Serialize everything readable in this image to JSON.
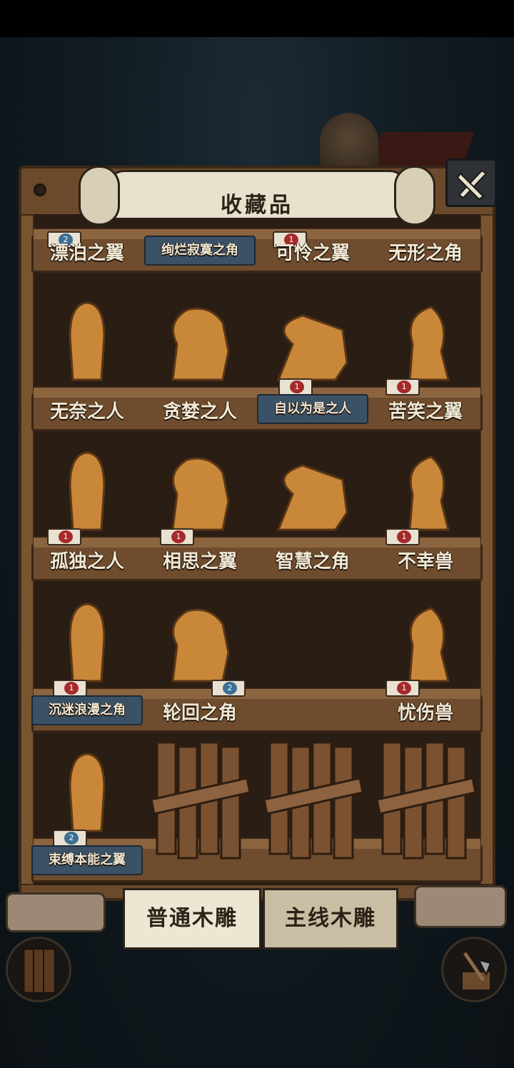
{
  "header": {
    "title": "收藏品"
  },
  "shelves": [
    {
      "items": [
        {
          "label": "漂泊之翼",
          "badge": "2",
          "badge_color": "blue",
          "style": "plain"
        },
        {
          "label": "绚烂寂寞之角",
          "badge": "",
          "style": "blue"
        },
        {
          "label": "可怜之翼",
          "badge": "1",
          "badge_color": "red",
          "style": "plain"
        },
        {
          "label": "无形之角",
          "badge": "",
          "style": "plain"
        }
      ]
    },
    {
      "items": [
        {
          "label": "无奈之人",
          "badge": "",
          "style": "plain"
        },
        {
          "label": "贪婪之人",
          "badge": "",
          "style": "plain"
        },
        {
          "label": "自以为是之人",
          "badge": "1",
          "badge_color": "red",
          "style": "blue"
        },
        {
          "label": "苦笑之翼",
          "badge": "1",
          "badge_color": "red",
          "style": "plain"
        }
      ]
    },
    {
      "items": [
        {
          "label": "孤独之人",
          "badge": "1",
          "badge_color": "red",
          "style": "plain"
        },
        {
          "label": "相思之翼",
          "badge": "1",
          "badge_color": "red",
          "style": "plain"
        },
        {
          "label": "智慧之角",
          "badge": "",
          "style": "plain"
        },
        {
          "label": "不幸兽",
          "badge": "1",
          "badge_color": "red",
          "style": "plain"
        }
      ]
    },
    {
      "items": [
        {
          "label": "沉迷浪漫之角",
          "badge": "1",
          "badge_color": "red",
          "style": "blue"
        },
        {
          "label": "轮回之角",
          "badge": "2",
          "badge_color": "blue",
          "style": "plain"
        },
        {
          "label": "",
          "badge": "",
          "style": "empty"
        },
        {
          "label": "忧伤兽",
          "badge": "1",
          "badge_color": "red",
          "style": "plain"
        }
      ]
    },
    {
      "items": [
        {
          "label": "束缚本能之翼",
          "badge": "2",
          "badge_color": "blue",
          "style": "blue"
        },
        {
          "label": "",
          "style": "locked"
        },
        {
          "label": "",
          "style": "locked"
        },
        {
          "label": "",
          "style": "locked"
        }
      ]
    }
  ],
  "tabs": [
    {
      "label": "普通木雕",
      "active": true
    },
    {
      "label": "主线木雕",
      "active": false
    }
  ],
  "colors": {
    "wood": "#6f4c2d",
    "label_text": "#f1e8d4",
    "paper": "#ede6d3",
    "highlight": "#3b5266"
  }
}
